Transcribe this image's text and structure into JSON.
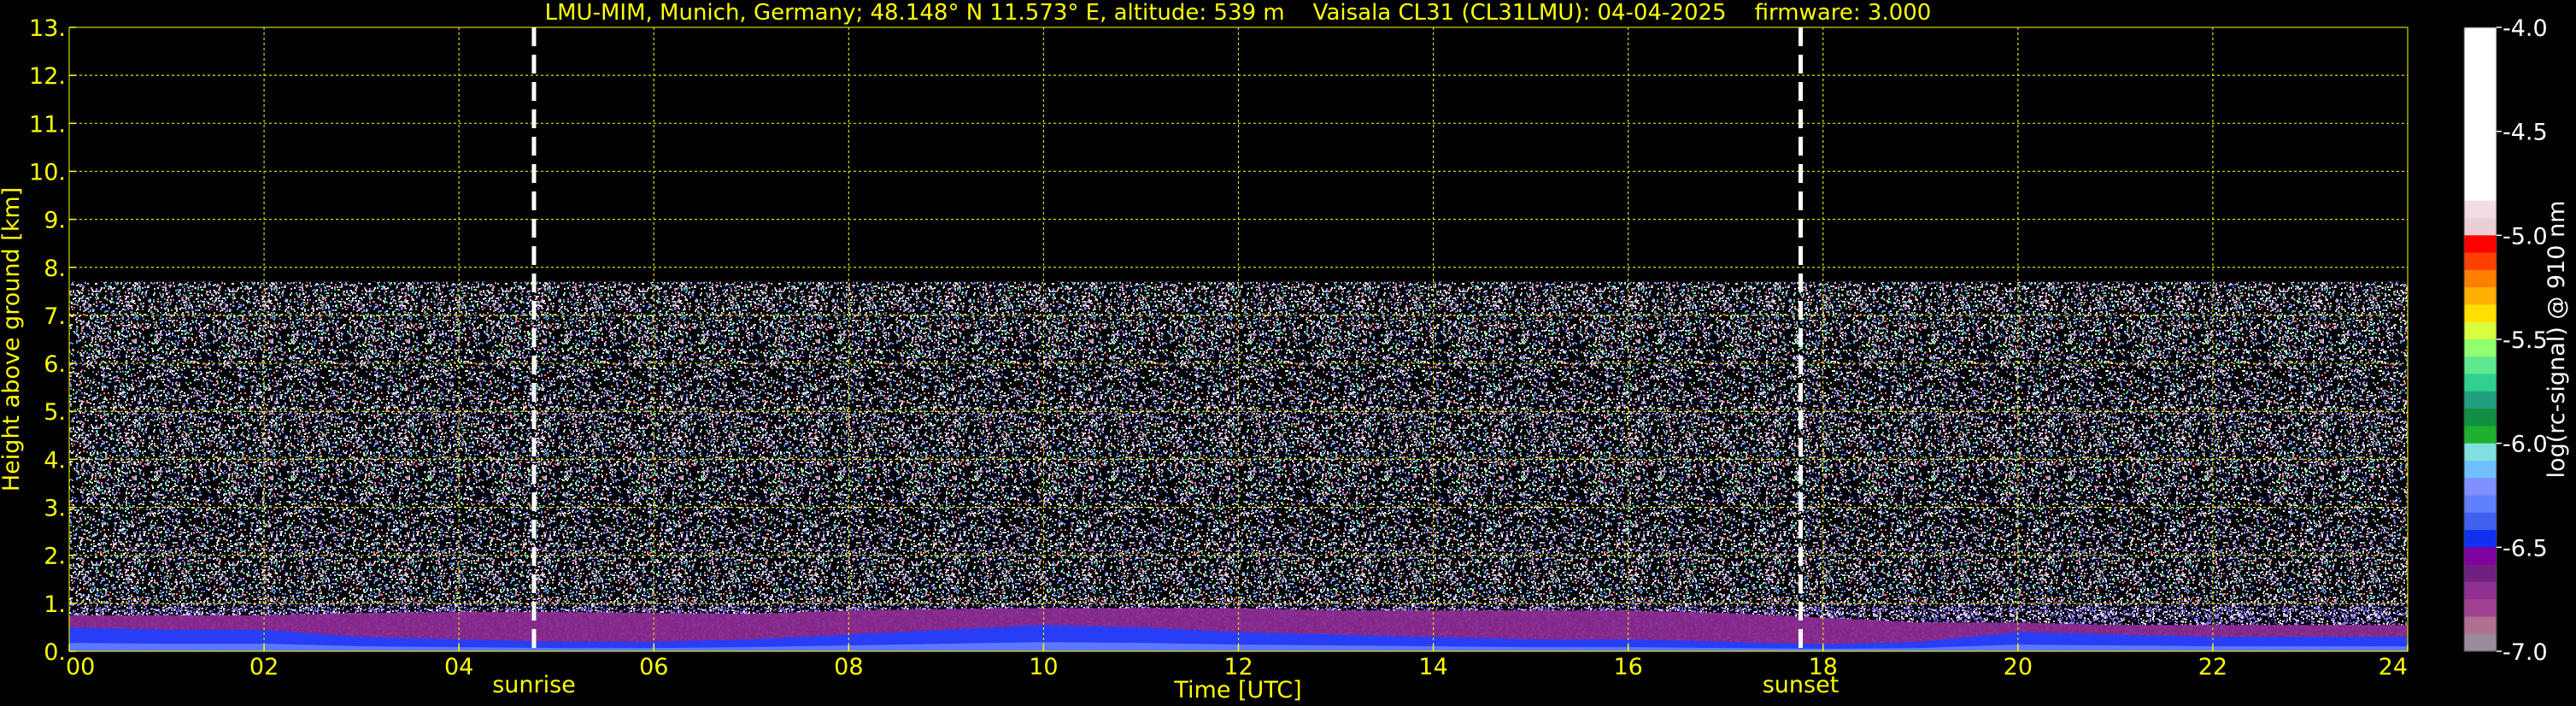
{
  "chart_data": {
    "type": "heatmap",
    "title": "LMU-MIM, Munich, Germany; 48.148° N 11.573° E, altitude: 539 m    Vaisala CL31 (CL31LMU): 04-04-2025    firmware: 3.000",
    "xlabel": "Time [UTC]",
    "ylabel": "Height above ground [km]",
    "colorbar_label": "log(rc-signal) @ 910 nm",
    "xlim": [
      0,
      24
    ],
    "ylim": [
      0,
      13
    ],
    "x_ticks": [
      0,
      2,
      4,
      6,
      8,
      10,
      12,
      14,
      16,
      18,
      20,
      22,
      24
    ],
    "x_tick_labels": [
      "00",
      "02",
      "04",
      "06",
      "08",
      "10",
      "12",
      "14",
      "16",
      "18",
      "20",
      "22",
      "24"
    ],
    "y_ticks": [
      0,
      1,
      2,
      3,
      4,
      5,
      6,
      7,
      8,
      9,
      10,
      11,
      12,
      13
    ],
    "y_tick_labels": [
      "0.",
      "1.",
      "2.",
      "3.",
      "4.",
      "5.",
      "6.",
      "7.",
      "8.",
      "9.",
      "10.",
      "11.",
      "12.",
      "13."
    ],
    "grid": true,
    "color_range": [
      -7.0,
      -4.0
    ],
    "colorbar_ticks": [
      -4.0,
      -4.5,
      -5.0,
      -5.5,
      -6.0,
      -6.5,
      -7.0
    ],
    "colorbar_tick_labels": [
      "-4.0",
      "-4.5",
      "-5.0",
      "-5.5",
      "-6.0",
      "-6.5",
      "-7.0"
    ],
    "colorbar_colors": [
      "#ffffff",
      "#ffffff",
      "#ffffff",
      "#ffffff",
      "#ffffff",
      "#ffffff",
      "#ffffff",
      "#ffffff",
      "#ffffff",
      "#ffffff",
      "#f4dde2",
      "#ead0d6",
      "#ff0000",
      "#ff4000",
      "#ff8000",
      "#ffb000",
      "#ffe000",
      "#d8ff40",
      "#90ff70",
      "#60e890",
      "#30d090",
      "#20a080",
      "#109040",
      "#20b030",
      "#80e0e0",
      "#70c0ff",
      "#8090ff",
      "#6080ff",
      "#4060f0",
      "#1030f0",
      "#8000a0",
      "#702080",
      "#903090",
      "#a04090",
      "#b07090",
      "#9a8a9a"
    ],
    "data_top_km": 7.7,
    "annotations": [
      {
        "label": "sunrise",
        "x": 4.77
      },
      {
        "label": "sunset",
        "x": 17.77
      }
    ],
    "boundary_layer_top_km": [
      [
        0,
        0.75
      ],
      [
        1,
        0.75
      ],
      [
        2,
        0.75
      ],
      [
        3,
        0.8
      ],
      [
        4,
        0.82
      ],
      [
        5,
        0.82
      ],
      [
        6,
        0.8
      ],
      [
        7,
        0.78
      ],
      [
        8,
        0.85
      ],
      [
        9,
        0.88
      ],
      [
        10,
        0.9
      ],
      [
        11,
        0.9
      ],
      [
        12,
        0.9
      ],
      [
        13,
        0.85
      ],
      [
        14,
        0.85
      ],
      [
        15,
        0.85
      ],
      [
        16,
        0.85
      ],
      [
        17,
        0.8
      ],
      [
        18,
        0.7
      ],
      [
        19,
        0.6
      ],
      [
        20,
        0.6
      ],
      [
        21,
        0.55
      ],
      [
        22,
        0.55
      ],
      [
        23,
        0.55
      ],
      [
        24,
        0.55
      ]
    ],
    "blue_layer_top_km": [
      [
        0,
        0.5
      ],
      [
        1,
        0.45
      ],
      [
        2,
        0.45
      ],
      [
        3,
        0.3
      ],
      [
        4,
        0.25
      ],
      [
        5,
        0.2
      ],
      [
        6,
        0.2
      ],
      [
        7,
        0.25
      ],
      [
        8,
        0.35
      ],
      [
        9,
        0.45
      ],
      [
        10,
        0.55
      ],
      [
        11,
        0.5
      ],
      [
        12,
        0.4
      ],
      [
        13,
        0.35
      ],
      [
        14,
        0.3
      ],
      [
        15,
        0.25
      ],
      [
        16,
        0.25
      ],
      [
        17,
        0.2
      ],
      [
        18,
        0.15
      ],
      [
        19,
        0.2
      ],
      [
        20,
        0.4
      ],
      [
        21,
        0.35
      ],
      [
        22,
        0.3
      ],
      [
        23,
        0.3
      ],
      [
        24,
        0.3
      ]
    ]
  }
}
